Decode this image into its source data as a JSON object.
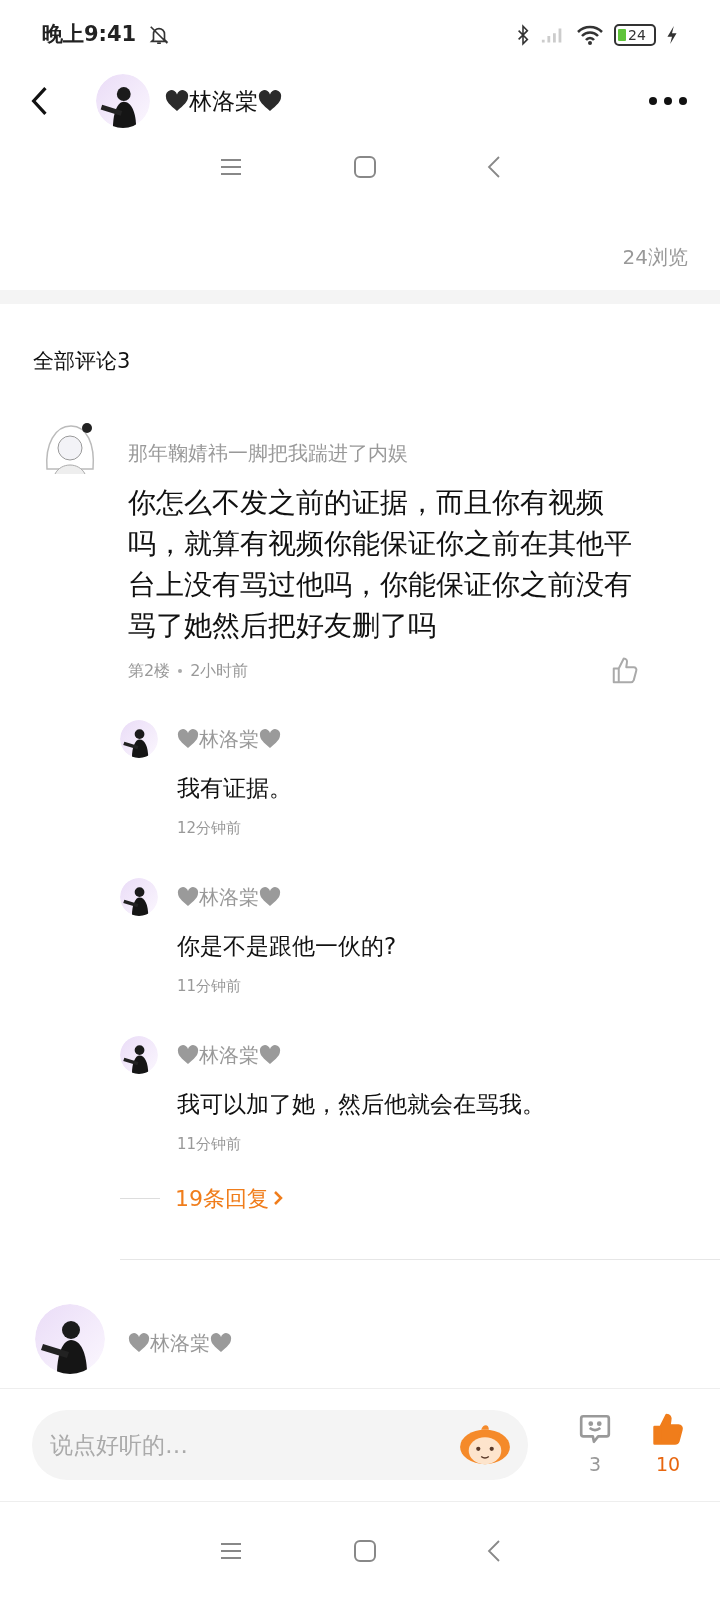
{
  "status_bar": {
    "time": "晚上9:41",
    "battery": "24"
  },
  "header": {
    "name": "林洛棠",
    "hearts": true
  },
  "views": "24浏览",
  "comments_title": "全部评论3",
  "comments": [
    {
      "author": "那年鞠婧祎一脚把我踹进了内娱",
      "hearts": false,
      "kind": "sketch",
      "text": "你怎么不发之前的证据，而且你有视频吗，就算有视频你能保证你之前在其他平台上没有骂过他吗，你能保证你之前没有骂了她然后把好友删了吗",
      "floor": "第2楼",
      "time": "2小时前",
      "liked": false,
      "replies": [
        {
          "author": "林洛棠",
          "hearts": true,
          "text": "我有证据。",
          "time": "12分钟前"
        },
        {
          "author": "林洛棠",
          "hearts": true,
          "text": "你是不是跟他一伙的?",
          "time": "11分钟前"
        },
        {
          "author": "林洛棠",
          "hearts": true,
          "text": "我可以加了她，然后他就会在骂我。",
          "time": "11分钟前"
        }
      ],
      "more_replies": "19条回复"
    },
    {
      "author": "林洛棠",
      "hearts": true,
      "kind": "portrait"
    }
  ],
  "composer": {
    "placeholder": "说点好听的…",
    "comment_count": "3",
    "like_count": "10",
    "liked": true
  }
}
